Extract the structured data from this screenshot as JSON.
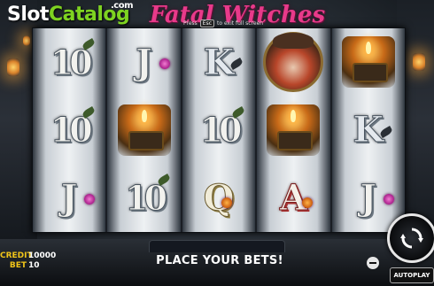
{
  "watermark": {
    "slot": "Slot",
    "catalog": "Catalog",
    "com": ".com"
  },
  "title": "Fatal Witches",
  "fullscreen_hint": {
    "press": "Press",
    "key": "Esc",
    "suffix": "to exit full screen"
  },
  "reels": [
    [
      "10",
      "10",
      "J"
    ],
    [
      "J",
      "candle-book",
      "10"
    ],
    [
      "K",
      "10",
      "Q"
    ],
    [
      "witch",
      "candle-book",
      "A"
    ],
    [
      "candle-book",
      "K",
      "J"
    ]
  ],
  "status": {
    "credit_label": "CREDIT",
    "credit_value": "10000",
    "bet_label": "BET",
    "bet_value": "10",
    "message": "PLACE YOUR BETS!"
  },
  "controls": {
    "autoplay_label": "AUTOPLAY",
    "spin_icon": "spin-arrows-icon",
    "minus_icon": "minus-icon"
  },
  "colors": {
    "title": "#e83a8a",
    "credit_label": "#f0c419",
    "logo_green": "#7ed321"
  }
}
